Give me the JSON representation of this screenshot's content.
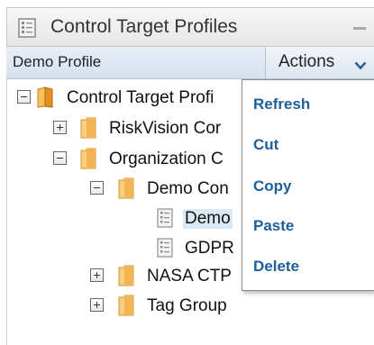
{
  "panel": {
    "title": "Control Target Profiles",
    "title_icon": "profile-document-icon",
    "minimize_icon": "minimize-icon"
  },
  "toolbar": {
    "profile_label": "Demo Profile",
    "actions_label": "Actions",
    "actions_icon": "chevron-down-icon"
  },
  "tree": {
    "nodes": [
      {
        "label": "Control Target Profi",
        "toggle": "minus",
        "icon": "open-folder-icon"
      },
      {
        "label": "RiskVision Cor",
        "toggle": "plus",
        "icon": "folder-icon"
      },
      {
        "label": "Organization C",
        "toggle": "minus",
        "icon": "folder-icon"
      },
      {
        "label": "Demo Con",
        "toggle": "minus",
        "icon": "folder-icon"
      },
      {
        "label": "Demo",
        "toggle": "none",
        "icon": "document-icon"
      },
      {
        "label": "GDPR",
        "toggle": "none",
        "icon": "document-icon"
      },
      {
        "label": "NASA CTP",
        "toggle": "plus",
        "icon": "folder-icon"
      },
      {
        "label": "Tag Group",
        "toggle": "plus",
        "icon": "folder-icon"
      }
    ]
  },
  "actions_menu": {
    "items": [
      "Refresh",
      "Cut",
      "Copy",
      "Paste",
      "Delete"
    ]
  },
  "colors": {
    "menu_text": "#1d5f99",
    "toolbar_bg": "#dde5ef",
    "folder": "#f0a43a"
  }
}
